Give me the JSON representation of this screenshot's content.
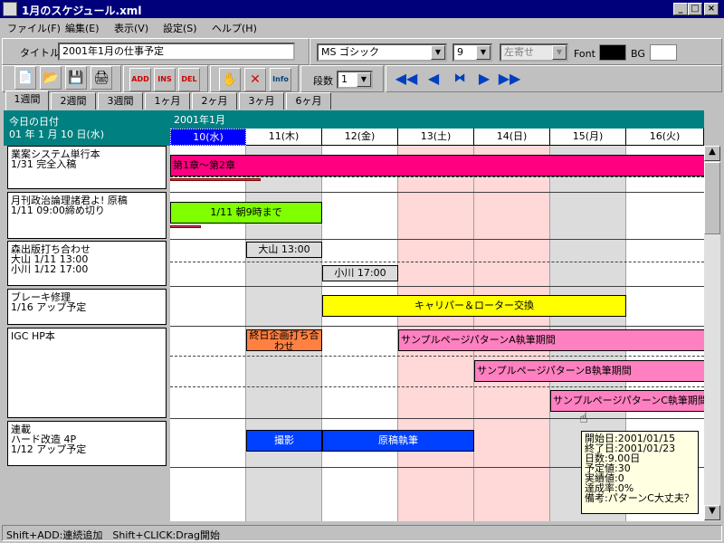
{
  "window": {
    "title": "1月のスケジュール.xml",
    "min": "_",
    "max": "□",
    "close": "×"
  },
  "menu": [
    "ファイル(F)",
    "編集(E)",
    "表示(V)",
    "設定(S)",
    "ヘルプ(H)"
  ],
  "toolbar1": {
    "title_label": "タイトル",
    "title_value": "2001年1月の仕事予定",
    "font_name": "MS ゴシック",
    "font_size": "9",
    "align": "左寄せ",
    "font_label": "Font",
    "bg_label": "BG",
    "font_color": "#000000",
    "bg_color": "#ffffff"
  },
  "toolbar2": {
    "rows_label": "段数",
    "rows_value": "1",
    "btn_add": "ADD",
    "btn_ins": "INS",
    "btn_del": "DEL",
    "btn_info": "Info"
  },
  "tabs": [
    "1週間",
    "2週間",
    "3週間",
    "1ヶ月",
    "2ヶ月",
    "3ヶ月",
    "6ヶ月"
  ],
  "today": {
    "label": "今日の日付",
    "value": "01 年 1 月 10 日(水)"
  },
  "month_label": "2001年1月",
  "dates": [
    "10(水)",
    "11(木)",
    "12(金)",
    "13(土)",
    "14(日)",
    "15(月)",
    "16(火)"
  ],
  "rows": [
    {
      "label": "業案システム単行本\n1/31 完全入稿"
    },
    {
      "label": "月刊政治論理諸君よ! 原稿\n1/11 09:00締め切り"
    },
    {
      "label": "森出版打ち合わせ\n大山 1/11 13:00\n小川 1/12 17:00"
    },
    {
      "label": "ブレーキ修理\n1/16 アップ予定"
    },
    {
      "label": "IGC HP本"
    },
    {
      "label": "連載\nハード改造 4P\n1/12 アップ予定"
    }
  ],
  "bars": [
    {
      "text": "第1章～第2章"
    },
    {
      "text": "1/11 朝9時まで"
    },
    {
      "text": "大山 13:00"
    },
    {
      "text": "小川 17:00"
    },
    {
      "text": "キャリパー＆ローター交換"
    },
    {
      "text": "終日企画打ち合わせ"
    },
    {
      "text": "サンプルページパターンA執筆期間"
    },
    {
      "text": "サンプルページパターンB執筆期間"
    },
    {
      "text": "サンプルページパターンC執筆期間"
    },
    {
      "text": "撮影"
    },
    {
      "text": "原稿執筆"
    }
  ],
  "tooltip": [
    "開始日:2001/01/15",
    "終了日:2001/01/23",
    "日数:9.00日",
    "予定値:30",
    "実績値:0",
    "達成率:0%",
    "備考:パターンC大丈夫？"
  ],
  "status": "Shift+ADD:連続追加　Shift+CLICK:Drag開始",
  "colors": {
    "teal": "#008080",
    "magenta": "#ff0080",
    "green": "#80ff00",
    "yellow": "#ffff00",
    "orange": "#ff8040",
    "pink": "#ff80c0",
    "blue": "#0040ff",
    "weekend": "#ffd8d8"
  }
}
